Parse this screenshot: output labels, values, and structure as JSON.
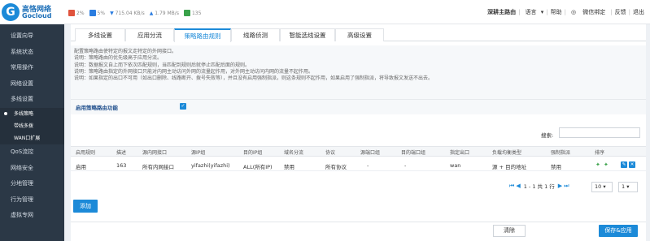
{
  "logo": {
    "cn": "高恪网络",
    "en": "Gocloud"
  },
  "stats": {
    "cpu": "2%",
    "mem": "5%",
    "down": "715.04 KB/s",
    "up": "1.79 MB/s",
    "conn": "135",
    "cpu_color": "#e0533d",
    "mem_color": "#2b7de0",
    "conn_color": "#3aa24a"
  },
  "topnav": {
    "device": "深耕主路由",
    "lang": "语言",
    "help": "帮助",
    "wechat": "微信绑定",
    "feedback": "反馈",
    "logout": "退出"
  },
  "sidebar": {
    "items": [
      "设置向导",
      "系统状态",
      "常用操作",
      "网络设置",
      "多线设置"
    ],
    "sub": [
      "多线策略",
      "带线多拨",
      "WAN口扩展"
    ],
    "items2": [
      "QoS流控",
      "网络安全",
      "分地管理",
      "行为管理",
      "虚拟专网"
    ]
  },
  "tabs": [
    "多线设置",
    "应用分流",
    "策略路由规则",
    "线路侦测",
    "智能选线设置",
    "高级设置"
  ],
  "notes": [
    "配置策略路由使特定的报文走特定的外网接口。",
    "说明：策略路由的优先级高于应用分流。",
    "说明：数据报文自上而下依次匹配规则，当匹配到规则后就停止匹配后面的规则。",
    "说明：策略路由指定的外网接口只能对内网主动访问外网的流量起作用，对外网主动访问内网的流量不起作用。",
    "说明：如果指定的出口不可用（如出口删除、线路断开、拨号失败等），并且没有启用强制指派，则这条规则不起作用，如果启用了强制指派，将导致报文发送不出去。"
  ],
  "enable": {
    "label": "启用策略路由功能",
    "checked": "✓"
  },
  "search": {
    "label": "搜索:",
    "placeholder": ""
  },
  "table": {
    "headers": [
      "启用规则",
      "描述",
      "源内网接口",
      "源IP组",
      "目的IP组",
      "域名分流",
      "协议",
      "源端口组",
      "目的端口组",
      "指定出口",
      "负载均衡类型",
      "强制指派",
      "排序"
    ],
    "row": [
      "启用",
      "163",
      "所有内网接口",
      "yifazhi(yifazhi)",
      "ALL(所有IP)",
      "禁用",
      "所有协议",
      "-",
      "-",
      "wan",
      "源 + 目的地址",
      "禁用"
    ]
  },
  "pager": {
    "text": "1 - 1 共 1 行",
    "page_size": "10",
    "page": "1"
  },
  "buttons": {
    "add": "添加",
    "clear": "清除",
    "save": "保存&应用"
  }
}
